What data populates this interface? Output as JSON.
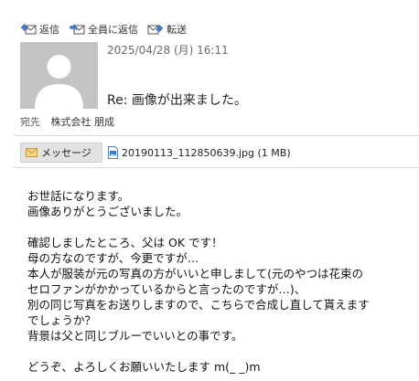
{
  "toolbar": {
    "reply": "返信",
    "reply_all": "全員に返信",
    "forward": "転送"
  },
  "header": {
    "date": "2025/04/28 (月) 16:11",
    "subject": "Re: 画像が出来ました。",
    "to_label": "宛先",
    "to_value": "株式会社 朋成"
  },
  "attachments": {
    "message_tab": "メッセージ",
    "file": "20190113_112850639.jpg (1 MB)"
  },
  "body": {
    "line1": "お世話になります。",
    "line2": "画像ありがとうございました。",
    "line3": "確認しましたところ、父は OK です！",
    "line4": "母の方なのですが、今更ですが…",
    "line5": "本人が服装が元の写真の方がいいと申しまして(元のやつは花束の",
    "line6": "セロファンがかかっているからと言ったのですが…)、",
    "line7": "別の同じ写真をお送りしますので、こちらで合成し直して貰えます",
    "line8": "でしょうか？",
    "line9": "背景は父と同じブルーでいいとの事です。",
    "line10": "どうぞ、よろしくお願いいたします m(_ _)m"
  },
  "colors": {
    "avatar_bg": "#c3c4c6",
    "icon_blue": "#3a7bd5"
  }
}
